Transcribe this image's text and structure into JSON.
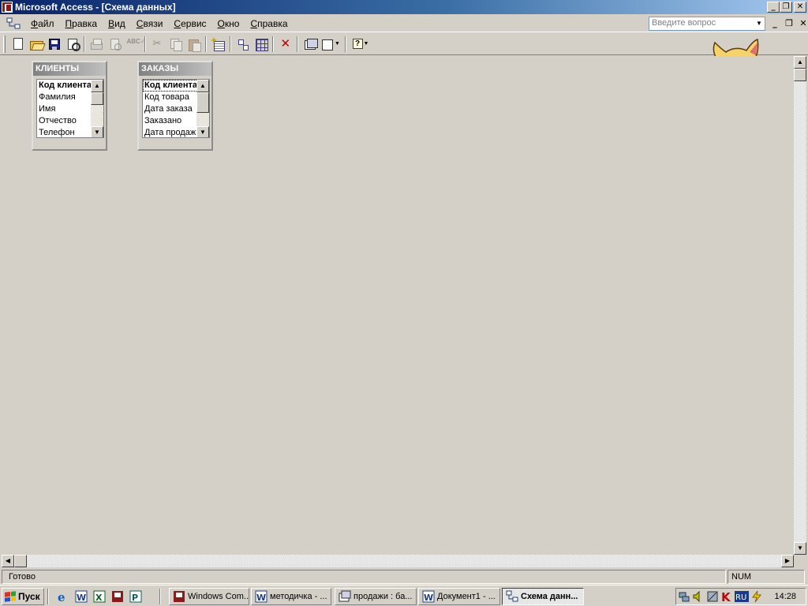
{
  "window": {
    "title": "Microsoft Access - [Схема данных]"
  },
  "menu": {
    "items": [
      "Файл",
      "Правка",
      "Вид",
      "Связи",
      "Сервис",
      "Окно",
      "Справка"
    ],
    "ask_placeholder": "Введите вопрос"
  },
  "toolbar": {
    "buttons": [
      "new-icon",
      "open-icon",
      "save-icon",
      "search-icon",
      "print-icon",
      "print-preview-icon",
      "spelling-icon",
      "cut-icon",
      "copy-icon",
      "paste-icon",
      "show-table-icon",
      "show-direct-icon",
      "show-all-icon",
      "delete-icon",
      "database-window-icon",
      "new-object-icon",
      "help-icon"
    ]
  },
  "tables": [
    {
      "title": "КЛИЕНТЫ",
      "fields": [
        "Код клиента",
        "Фамилия",
        "Имя",
        "Отчество",
        "Телефон"
      ]
    },
    {
      "title": "ЗАКАЗЫ",
      "fields": [
        "Код клиента",
        "Код товара",
        "Дата заказа",
        "Заказано",
        "Дата продаж"
      ]
    }
  ],
  "status": {
    "text": "Готово",
    "num": "NUM"
  },
  "taskbar": {
    "start_label": "Пуск",
    "tasks": [
      {
        "label": "Windows Com..."
      },
      {
        "label": "методичка - ..."
      },
      {
        "label": "продажи : ба..."
      },
      {
        "label": "Документ1 - ..."
      },
      {
        "label": "Схема данн..."
      }
    ],
    "tray_lang": "RU",
    "clock": "14:28"
  },
  "colors": {
    "titlebar_start": "#0a246a",
    "titlebar_end": "#a6caf0",
    "face": "#d4d0c8"
  }
}
